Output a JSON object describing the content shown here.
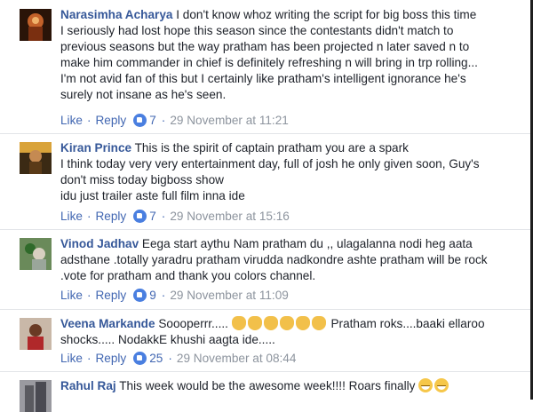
{
  "colors": {
    "author": "#365899",
    "link": "#4267b2",
    "meta": "#8d949e",
    "text": "#1d2129"
  },
  "comments": [
    {
      "author": "Narasimha Acharya",
      "text_lines": [
        "I don't know whoz writing the script for big boss this time",
        "I seriously had lost hope this season since the contestants didn't match to",
        "previous seasons but the way pratham has been projected n later saved n to",
        "make him commander in chief is definitely refreshing n will bring in trp rolling...",
        "I'm not avid fan of this but I certainly like pratham's intelligent ignorance he's",
        "surely not insane as he's seen."
      ],
      "like_label": "Like",
      "reply_label": "Reply",
      "likes": "7",
      "timestamp": "29 November at 11:21",
      "avatar_icon": "avatar-narasimha"
    },
    {
      "author": "Kiran Prince",
      "text_lines": [
        "This is the spirit of captain pratham you are a spark",
        "I think today very very entertainment day, full of josh he only given soon, Guy's",
        "don't miss today bigboss show",
        "idu just trailer aste full film inna ide"
      ],
      "like_label": "Like",
      "reply_label": "Reply",
      "likes": "7",
      "timestamp": "29 November at 15:16",
      "avatar_icon": "avatar-kiran"
    },
    {
      "author": "Vinod Jadhav",
      "text_lines": [
        "Eega start aythu Nam pratham du ,, ulagalanna nodi heg aata",
        "adsthane .totally yaradru pratham virudda nadkondre ashte pratham will be rock",
        ".vote for pratham and thank you colors channel."
      ],
      "like_label": "Like",
      "reply_label": "Reply",
      "likes": "9",
      "timestamp": "29 November at 11:09",
      "avatar_icon": "avatar-vinod"
    },
    {
      "author": "Veena Markande",
      "text_lines": [
        "Soooperrr.....",
        "Pratham roks....baaki ellaroo",
        "shocks..... NodakkE khushi aagta ide....."
      ],
      "emojis": [
        "ok-hand-icon",
        "ok-hand-icon",
        "ok-hand-icon",
        "thumbs-up-icon",
        "thumbs-up-icon",
        "thumbs-up-icon"
      ],
      "like_label": "Like",
      "reply_label": "Reply",
      "likes": "25",
      "timestamp": "29 November at 08:44",
      "avatar_icon": "avatar-veena"
    },
    {
      "author": "Rahul Raj",
      "text_lines": [
        "This week would be the awesome week!!!! Roars finally"
      ],
      "emojis": [
        "grinning-sweat-icon",
        "grinning-sweat-icon"
      ],
      "avatar_icon": "avatar-rahul"
    }
  ]
}
